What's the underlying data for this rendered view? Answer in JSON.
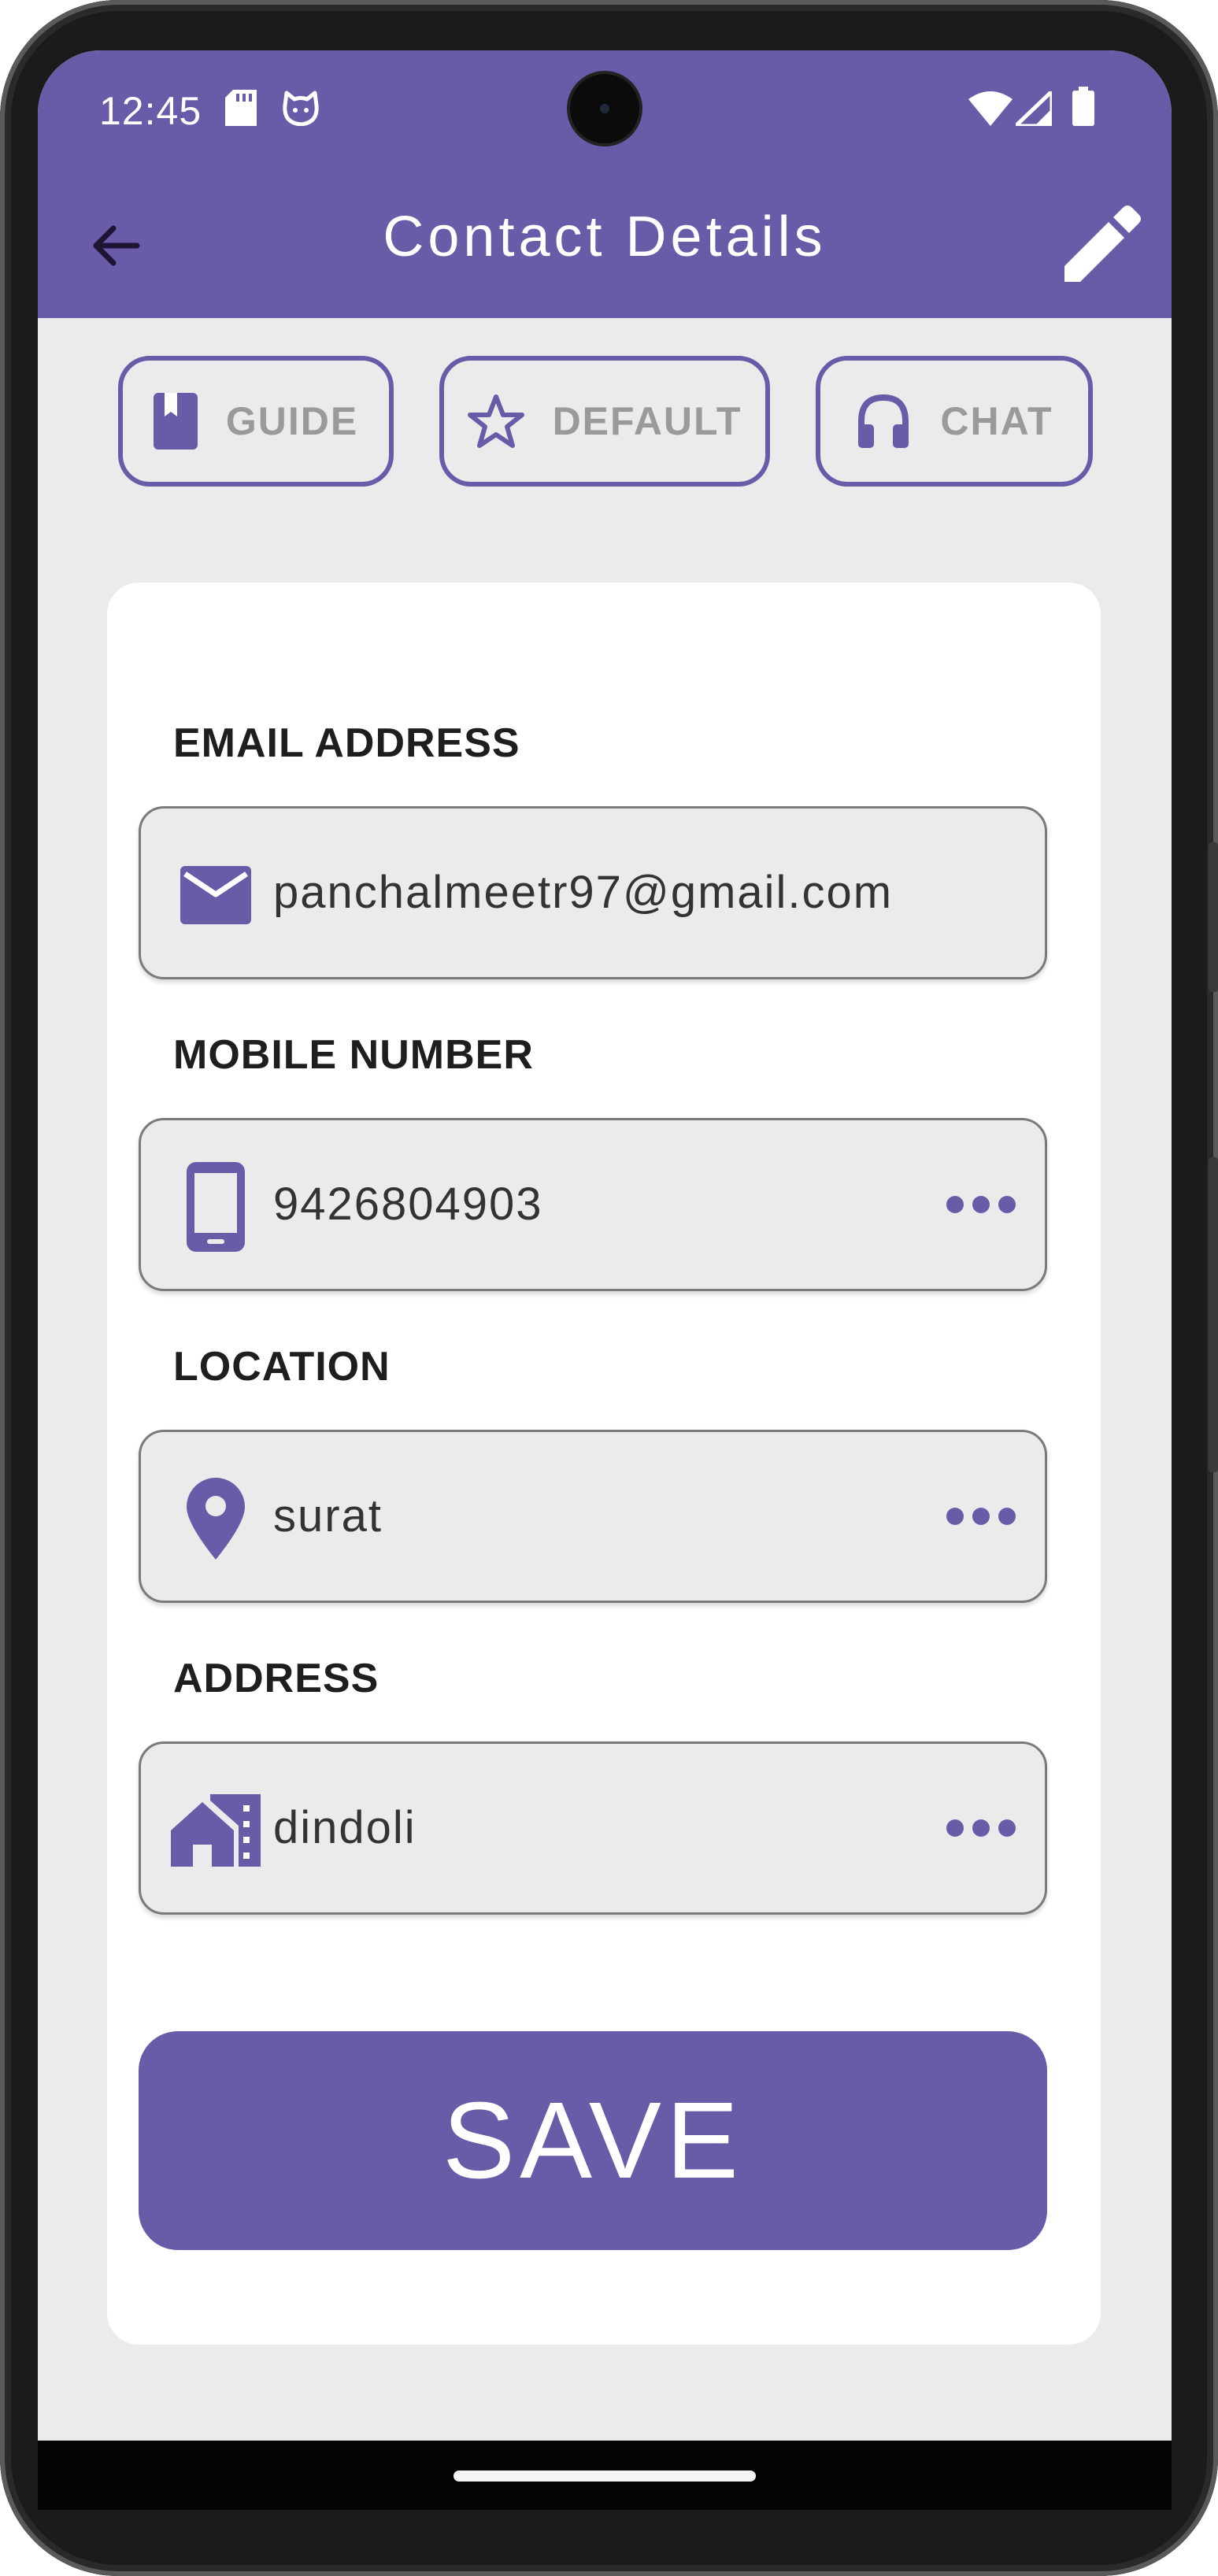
{
  "status_bar": {
    "time": "12:45",
    "left_icons": [
      "sd-card-icon",
      "cat-face-icon"
    ],
    "right_icons": [
      "wifi-icon",
      "signal-icon",
      "battery-icon"
    ]
  },
  "header": {
    "title": "Contact Details",
    "back_icon": "arrow-back-icon",
    "edit_icon": "pencil-icon"
  },
  "chips": [
    {
      "label": "GUIDE",
      "icon": "book-icon"
    },
    {
      "label": "DEFAULT",
      "icon": "star-outline-icon"
    },
    {
      "label": "CHAT",
      "icon": "headset-icon"
    }
  ],
  "form": {
    "email": {
      "label": "EMAIL ADDRESS",
      "value": "panchalmeetr97@gmail.com",
      "icon": "mail-icon"
    },
    "mobile": {
      "label": "MOBILE NUMBER",
      "value": "9426804903",
      "icon": "phone-icon"
    },
    "location": {
      "label": "LOCATION",
      "value": "surat",
      "icon": "location-pin-icon"
    },
    "address": {
      "label": "ADDRESS",
      "value": "dindoli",
      "icon": "house-icon"
    }
  },
  "save_label": "SAVE",
  "colors": {
    "primary": "#6a5ba9",
    "background": "#ebebeb",
    "card": "#ffffff",
    "chip_text": "#9a9a9a"
  }
}
